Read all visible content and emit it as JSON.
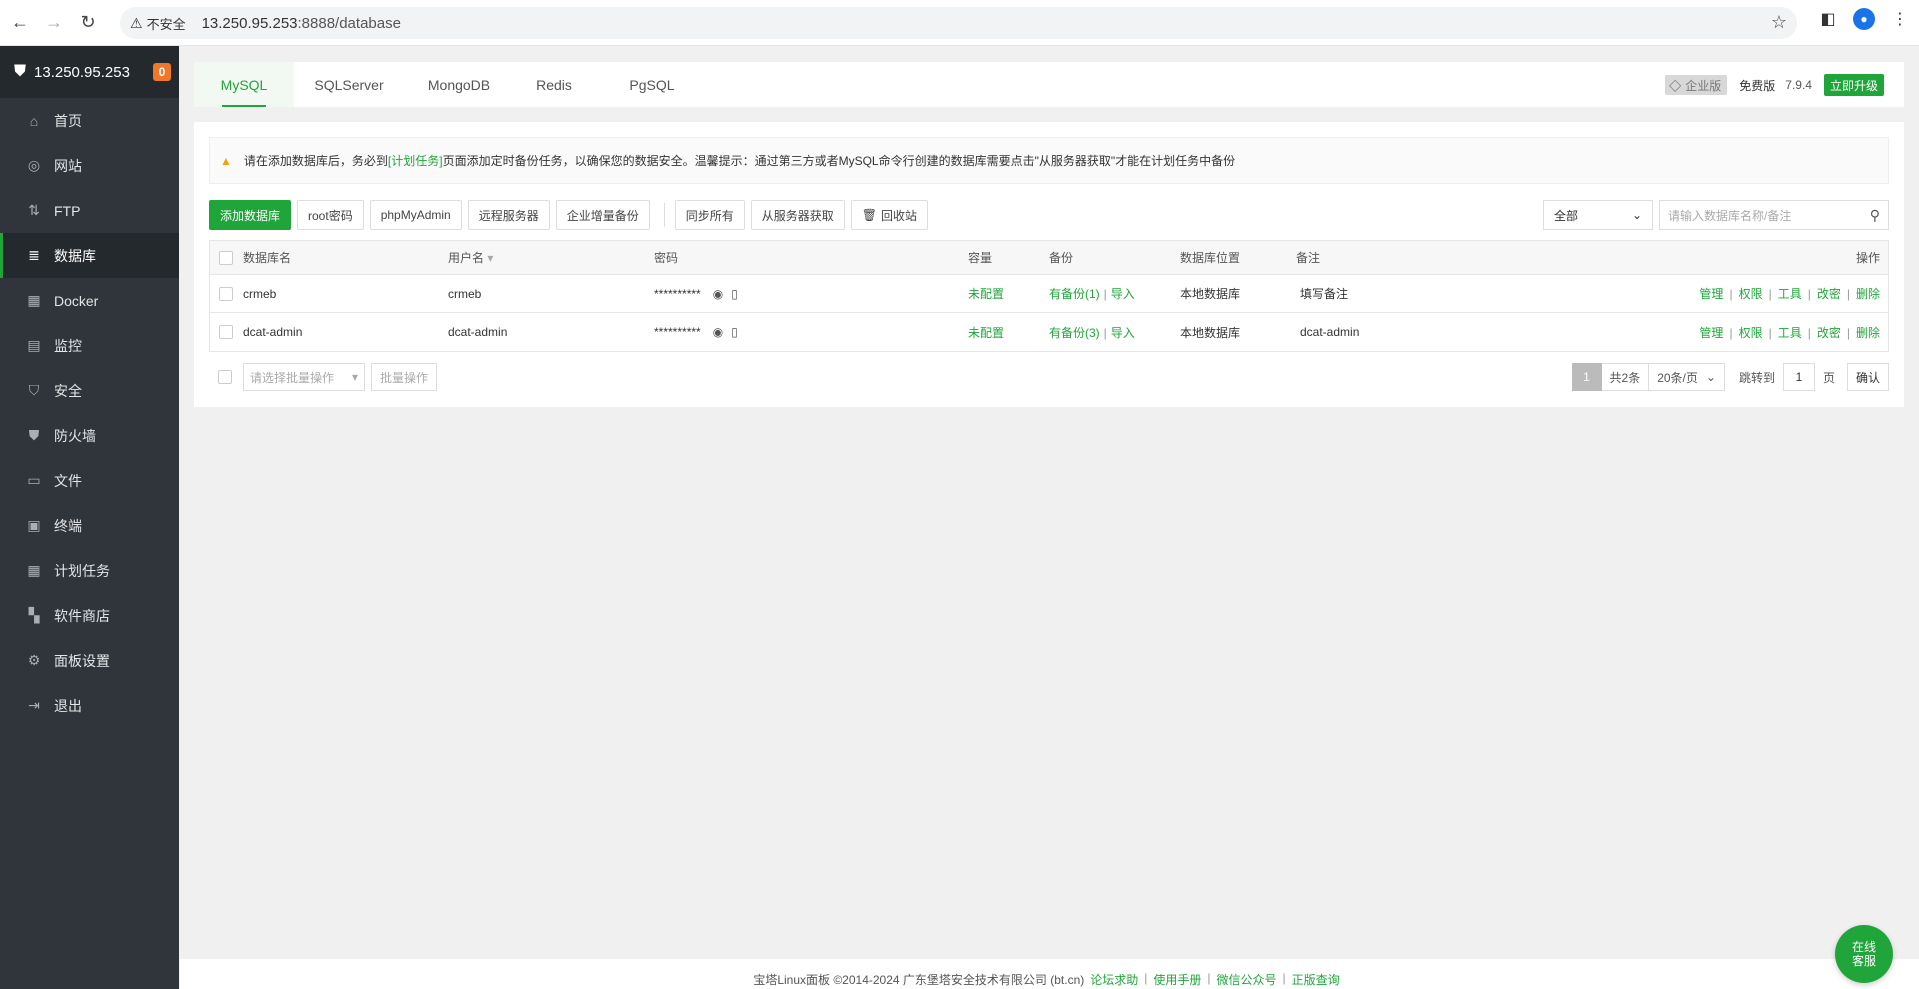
{
  "browser": {
    "security_label": "不安全",
    "url_host": "13.250.95.253",
    "url_path": ":8888/database"
  },
  "sidebar": {
    "server": "13.250.95.253",
    "badge": "0",
    "items": [
      {
        "label": "首页",
        "icon": "home-icon",
        "glyph": "⌂"
      },
      {
        "label": "网站",
        "icon": "globe-icon",
        "glyph": "◎"
      },
      {
        "label": "FTP",
        "icon": "ftp-icon",
        "glyph": "⇅"
      },
      {
        "label": "数据库",
        "icon": "database-icon",
        "glyph": "≣"
      },
      {
        "label": "Docker",
        "icon": "docker-icon",
        "glyph": "▦"
      },
      {
        "label": "监控",
        "icon": "monitor-icon",
        "glyph": "▤"
      },
      {
        "label": "安全",
        "icon": "shield-icon",
        "glyph": "⛉"
      },
      {
        "label": "防火墙",
        "icon": "firewall-icon",
        "glyph": "⛊"
      },
      {
        "label": "文件",
        "icon": "folder-icon",
        "glyph": "▭"
      },
      {
        "label": "终端",
        "icon": "terminal-icon",
        "glyph": "▣"
      },
      {
        "label": "计划任务",
        "icon": "calendar-icon",
        "glyph": "▦"
      },
      {
        "label": "软件商店",
        "icon": "apps-icon",
        "glyph": "▚"
      },
      {
        "label": "面板设置",
        "icon": "gear-icon",
        "glyph": "⚙"
      },
      {
        "label": "退出",
        "icon": "logout-icon",
        "glyph": "⇥"
      }
    ]
  },
  "tabs": [
    "MySQL",
    "SQLServer",
    "MongoDB",
    "Redis",
    "PgSQL"
  ],
  "topright": {
    "enterprise": "企业版",
    "free": "免费版",
    "version": "7.9.4",
    "upgrade": "立即升级"
  },
  "notice": {
    "before": "请在添加数据库后，务必到",
    "link": "[计划任务]",
    "after": "页面添加定时备份任务，以确保您的数据安全。温馨提示：通过第三方或者MySQL命令行创建的数据库需要点击\"从服务器获取\"才能在计划任务中备份"
  },
  "buttons": {
    "add": "添加数据库",
    "root": "root密码",
    "pma": "phpMyAdmin",
    "remote": "远程服务器",
    "incremental": "企业增量备份",
    "sync": "同步所有",
    "fetch": "从服务器获取",
    "recycle": "回收站"
  },
  "filter": {
    "selected": "全部",
    "placeholder": "请输入数据库名称/备注"
  },
  "table": {
    "headers": {
      "name": "数据库名",
      "user": "用户名",
      "password": "密码",
      "capacity": "容量",
      "backup": "备份",
      "location": "数据库位置",
      "remark": "备注",
      "ops": "操作"
    },
    "rows": [
      {
        "name": "crmeb",
        "user": "crmeb",
        "password": "**********",
        "capacity": "未配置",
        "backup": "有备份(1)",
        "import": "导入",
        "location": "本地数据库",
        "remark": "填写备注"
      },
      {
        "name": "dcat-admin",
        "user": "dcat-admin",
        "password": "**********",
        "capacity": "未配置",
        "backup": "有备份(3)",
        "import": "导入",
        "location": "本地数据库",
        "remark": "dcat-admin"
      }
    ],
    "ops": [
      "管理",
      "权限",
      "工具",
      "改密",
      "删除"
    ]
  },
  "batch": {
    "placeholder": "请选择批量操作",
    "button": "批量操作"
  },
  "pager": {
    "current": "1",
    "total": "共2条",
    "size": "20条/页",
    "jump_label": "跳转到",
    "jump_value": "1",
    "page_unit": "页",
    "confirm": "确认"
  },
  "footer": {
    "copyright": "宝塔Linux面板 ©2014-2024 广东堡塔安全技术有限公司 (bt.cn)",
    "links": [
      "论坛求助",
      "使用手册",
      "微信公众号",
      "正版查询"
    ]
  },
  "service": {
    "line1": "在线",
    "line2": "客服"
  },
  "colors": {
    "accent": "#20a53a",
    "sidebar": "#30353b",
    "badge": "#f0782a"
  }
}
